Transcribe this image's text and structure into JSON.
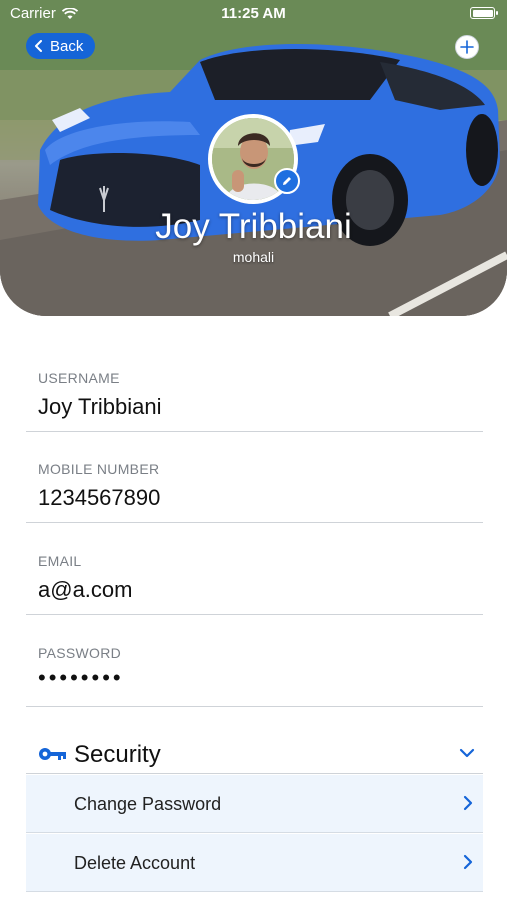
{
  "status_bar": {
    "carrier": "Carrier",
    "time": "11:25 AM"
  },
  "header": {
    "back_label": "Back"
  },
  "profile": {
    "name": "Joy Tribbiani",
    "city": "mohali"
  },
  "fields": [
    {
      "label": "USERNAME",
      "value": "Joy Tribbiani"
    },
    {
      "label": "MOBILE NUMBER",
      "value": "1234567890"
    },
    {
      "label": "EMAIL",
      "value": "a@a.com"
    },
    {
      "label": "PASSWORD",
      "value": "••••••••"
    }
  ],
  "security": {
    "title": "Security",
    "items": [
      {
        "label": "Change Password"
      },
      {
        "label": "Delete Account"
      }
    ]
  },
  "colors": {
    "accent": "#1565d8",
    "car": "#2f6fe0",
    "row_bg": "#eef5fd"
  },
  "icons": [
    "wifi-icon",
    "battery-icon",
    "chevron-left-icon",
    "plus-icon",
    "pencil-icon",
    "key-icon",
    "chevron-down-icon",
    "chevron-right-icon"
  ]
}
